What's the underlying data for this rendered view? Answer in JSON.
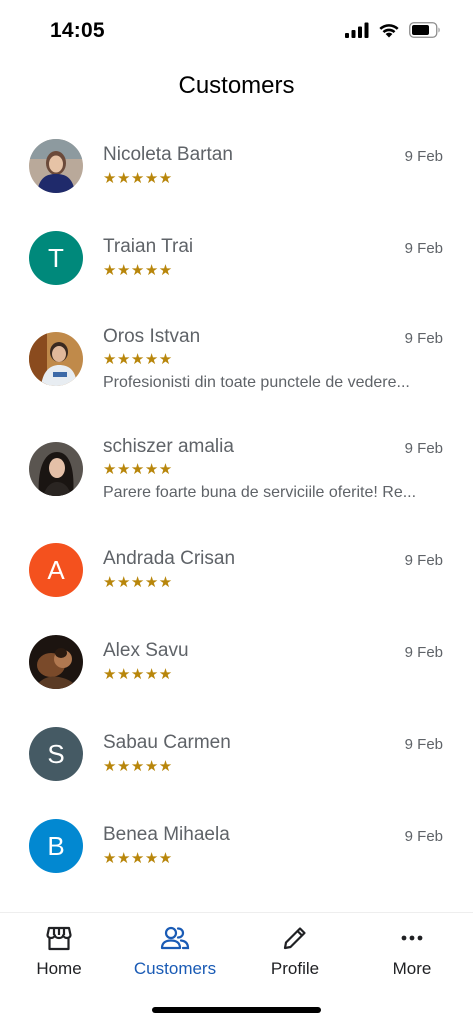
{
  "status_bar": {
    "time": "14:05"
  },
  "header": {
    "title": "Customers"
  },
  "colors": {
    "accent": "#1a5bb5",
    "star": "#b8860b"
  },
  "customers": [
    {
      "name": "Nicoleta Bartan",
      "date": "9 Feb",
      "stars": "★★★★★",
      "rating": 5,
      "avatar_type": "photo",
      "snippet": ""
    },
    {
      "name": "Traian Trai",
      "date": "9 Feb",
      "stars": "★★★★★",
      "rating": 5,
      "avatar_type": "initial",
      "initial": "T",
      "avatar_color": "#00897b",
      "snippet": ""
    },
    {
      "name": "Oros Istvan",
      "date": "9 Feb",
      "stars": "★★★★★",
      "rating": 5,
      "avatar_type": "photo",
      "snippet": "Profesionisti din toate punctele de vedere..."
    },
    {
      "name": "schiszer amalia",
      "date": "9 Feb",
      "stars": "★★★★★",
      "rating": 5,
      "avatar_type": "photo",
      "snippet": "Parere foarte buna de serviciile oferite! Re..."
    },
    {
      "name": "Andrada Crisan",
      "date": "9 Feb",
      "stars": "★★★★★",
      "rating": 5,
      "avatar_type": "initial",
      "initial": "A",
      "avatar_color": "#f4511e",
      "snippet": ""
    },
    {
      "name": "Alex Savu",
      "date": "9 Feb",
      "stars": "★★★★★",
      "rating": 5,
      "avatar_type": "photo",
      "snippet": ""
    },
    {
      "name": "Sabau Carmen",
      "date": "9 Feb",
      "stars": "★★★★★",
      "rating": 5,
      "avatar_type": "initial",
      "initial": "S",
      "avatar_color": "#455a64",
      "snippet": ""
    },
    {
      "name": "Benea Mihaela",
      "date": "9 Feb",
      "stars": "★★★★★",
      "rating": 5,
      "avatar_type": "initial",
      "initial": "B",
      "avatar_color": "#0288d1",
      "snippet": ""
    }
  ],
  "nav": {
    "items": [
      {
        "label": "Home",
        "icon": "storefront-icon"
      },
      {
        "label": "Customers",
        "icon": "people-icon",
        "active": true
      },
      {
        "label": "Profile",
        "icon": "pencil-icon"
      },
      {
        "label": "More",
        "icon": "more-dots-icon"
      }
    ]
  }
}
